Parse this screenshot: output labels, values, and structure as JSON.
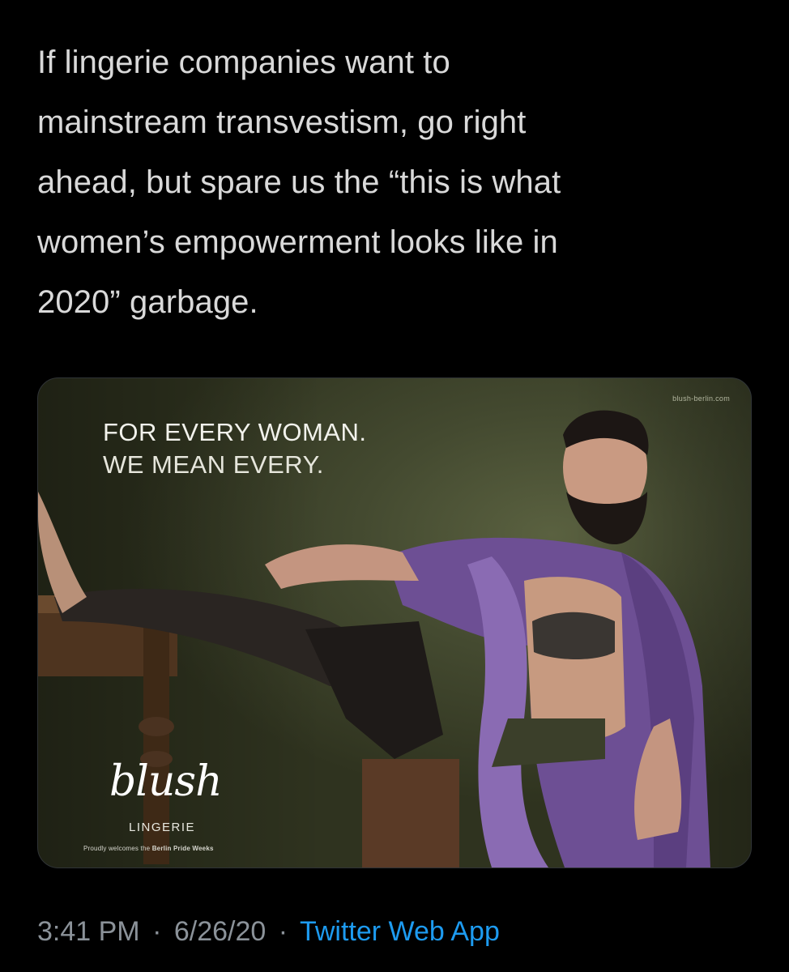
{
  "tweet": {
    "text": "If lingerie companies want to\nmainstream transvestism, go right\nahead, but spare us the “this is what\nwomen’s empowerment looks like in\n2020” garbage.",
    "media": {
      "watermark": "blush-berlin.com",
      "headline": "FOR EVERY WOMAN.",
      "subheadline": "WE MEAN EVERY.",
      "brand_logo": "blush",
      "brand_sub": "LINGERIE",
      "brand_note_prefix": "Proudly welcomes the",
      "brand_note_bold": "Berlin Pride Weeks"
    },
    "meta": {
      "time": "3:41 PM",
      "separator": "·",
      "date": "6/26/20",
      "source": "Twitter Web App"
    }
  },
  "colors": {
    "background": "#000000",
    "text": "#d9d9d9",
    "meta": "#8b9299",
    "link": "#1d9bf0",
    "robe": "#7a5ba0"
  }
}
